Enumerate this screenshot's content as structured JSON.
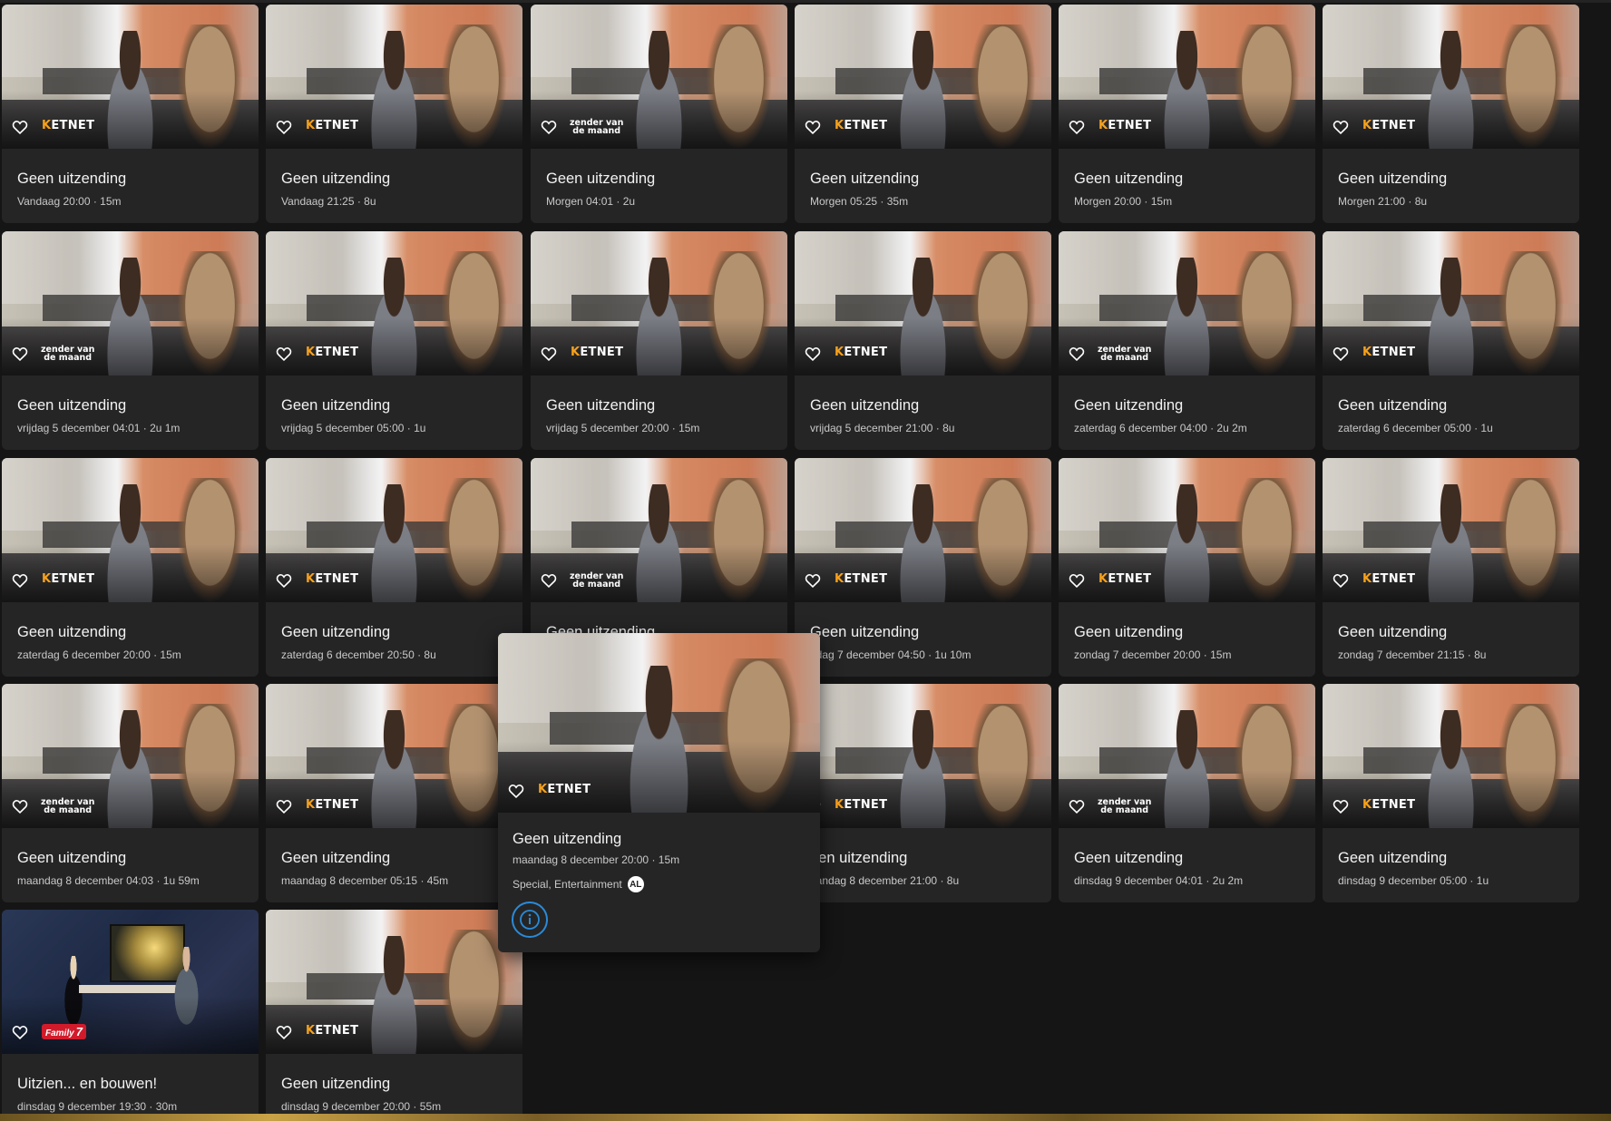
{
  "cards": [
    {
      "title": "Geen uitzending",
      "meta": "Vandaag 20:00 · 15m",
      "logo": "ketnet",
      "thumb": "couch-tv"
    },
    {
      "title": "Geen uitzending",
      "meta": "Vandaag 21:25 · 8u",
      "logo": "ketnet",
      "thumb": "couch-tv"
    },
    {
      "title": "Geen uitzending",
      "meta": "Morgen 04:01 · 2u",
      "logo": "zender-van-de-maand",
      "thumb": "couch-tv"
    },
    {
      "title": "Geen uitzending",
      "meta": "Morgen 05:25 · 35m",
      "logo": "ketnet",
      "thumb": "couch-tv"
    },
    {
      "title": "Geen uitzending",
      "meta": "Morgen 20:00 · 15m",
      "logo": "ketnet",
      "thumb": "couch-tv"
    },
    {
      "title": "Geen uitzending",
      "meta": "Morgen 21:00 · 8u",
      "logo": "ketnet",
      "thumb": "couch-tv"
    },
    {
      "title": "Geen uitzending",
      "meta": "vrijdag 5 december 04:01 · 2u 1m",
      "logo": "zender-van-de-maand",
      "thumb": "couch-tv"
    },
    {
      "title": "Geen uitzending",
      "meta": "vrijdag 5 december 05:00 · 1u",
      "logo": "ketnet",
      "thumb": "couch-tv"
    },
    {
      "title": "Geen uitzending",
      "meta": "vrijdag 5 december 20:00 · 15m",
      "logo": "ketnet",
      "thumb": "couch-tv"
    },
    {
      "title": "Geen uitzending",
      "meta": "vrijdag 5 december 21:00 · 8u",
      "logo": "ketnet",
      "thumb": "couch-tv"
    },
    {
      "title": "Geen uitzending",
      "meta": "zaterdag 6 december 04:00 · 2u 2m",
      "logo": "zender-van-de-maand",
      "thumb": "couch-tv"
    },
    {
      "title": "Geen uitzending",
      "meta": "zaterdag 6 december 05:00 · 1u",
      "logo": "ketnet",
      "thumb": "couch-tv"
    },
    {
      "title": "Geen uitzending",
      "meta": "zaterdag 6 december 20:00 · 15m",
      "logo": "ketnet",
      "thumb": "couch-tv"
    },
    {
      "title": "Geen uitzending",
      "meta": "zaterdag 6 december 20:50 · 8u",
      "logo": "ketnet",
      "thumb": "couch-tv"
    },
    {
      "title": "Geen uitzending",
      "meta": "",
      "logo": "zender-van-de-maand",
      "thumb": "couch-tv"
    },
    {
      "title": "Geen uitzending",
      "meta": "ndag 7 december 04:50 · 1u 10m",
      "logo": "ketnet",
      "thumb": "couch-tv"
    },
    {
      "title": "Geen uitzending",
      "meta": "zondag 7 december 20:00 · 15m",
      "logo": "ketnet",
      "thumb": "couch-tv"
    },
    {
      "title": "Geen uitzending",
      "meta": "zondag 7 december 21:15 · 8u",
      "logo": "ketnet",
      "thumb": "couch-tv"
    },
    {
      "title": "Geen uitzending",
      "meta": "maandag 8 december 04:03 · 1u 59m",
      "logo": "zender-van-de-maand",
      "thumb": "couch-tv"
    },
    {
      "title": "Geen uitzending",
      "meta": "maandag 8 december 05:15 · 45m",
      "logo": "ketnet",
      "thumb": "couch-tv"
    },
    {
      "title": "",
      "meta": "",
      "logo": "ketnet",
      "thumb": "couch-tv"
    },
    {
      "title": "een uitzending",
      "meta": "aandag 8 december 21:00 · 8u",
      "logo": "ketnet",
      "thumb": "couch-tv"
    },
    {
      "title": "Geen uitzending",
      "meta": "dinsdag 9 december 04:01 · 2u 2m",
      "logo": "zender-van-de-maand",
      "thumb": "couch-tv"
    },
    {
      "title": "Geen uitzending",
      "meta": "dinsdag 9 december 05:00 · 1u",
      "logo": "ketnet",
      "thumb": "couch-tv"
    },
    {
      "title": "Uitzien... en bouwen!",
      "meta": "dinsdag 9 december 19:30 · 30m",
      "logo": "family7",
      "thumb": "studio"
    },
    {
      "title": "Geen uitzending",
      "meta": "dinsdag 9 december 20:00 · 55m",
      "logo": "ketnet",
      "thumb": "couch-tv"
    }
  ],
  "logos": {
    "ketnet": {
      "k": "K",
      "rest": "ETNET"
    },
    "zender_van_de_maand": {
      "line1": "zender van",
      "line2": "de maand"
    },
    "family7": {
      "text": "Family",
      "num": "7"
    }
  },
  "popup": {
    "title": "Geen uitzending",
    "meta": "maandag 8 december 20:00 · 15m",
    "genres": "Special, Entertainment",
    "rating": "AL",
    "logo": "ketnet"
  },
  "colors": {
    "background": "#151515",
    "card": "#252525",
    "ketnet_accent": "#f6a11c",
    "info_accent": "#2a8ad8",
    "family7_red": "#d11b2b"
  },
  "icons": [
    "heart-outline-icon",
    "info-icon"
  ]
}
